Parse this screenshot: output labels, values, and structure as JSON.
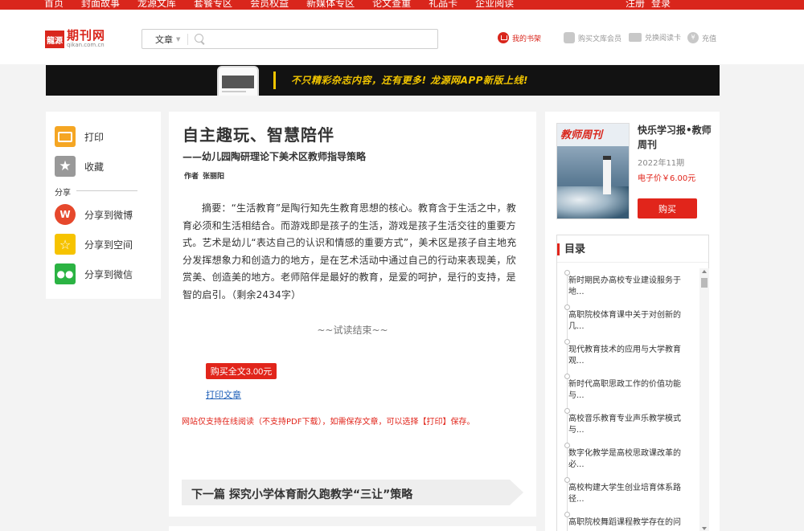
{
  "topnav": {
    "links": [
      "首页",
      "封面故事",
      "龙源文库",
      "套餐专区",
      "会员权益",
      "新媒体专区",
      "论文查重",
      "礼品卡",
      "企业阅读"
    ],
    "register": "注册",
    "login": "登录"
  },
  "header": {
    "logo_badge": "龍源",
    "logo_name": "期刊网",
    "logo_domain": "qikan.com.cn",
    "search_scope": "文章",
    "search_placeholder": "",
    "my_shelf": "我的书架",
    "buy_vip": "购买文库会员",
    "redeem_card": "兑换阅读卡",
    "recharge": "充值",
    "recharge_symbol": "¥"
  },
  "banner": {
    "slogan": "不只精彩杂志内容，还有更多! 龙源网APP新版上线!"
  },
  "share": {
    "print": "打印",
    "favorite": "收藏",
    "section": "分享",
    "weibo": "分享到微博",
    "qzone": "分享到空间",
    "wechat": "分享到微信"
  },
  "article": {
    "title": "自主趣玩、智慧陪伴",
    "subtitle": "——幼儿园陶研理论下美术区教师指导策略",
    "author_label": "作者",
    "author": "张丽阳",
    "abstract": "摘要：“生活教育”是陶行知先生教育思想的核心。教育含于生活之中，教育必须和生活相结合。而游戏即是孩子的生活，游戏是孩子生活交往的重要方式。艺术是幼儿“表达自己的认识和情感的重要方式”，美术区是孩子自主地充分发挥想象力和创造力的地方，是在艺术活动中通过自己的行动来表现美，欣赏美、创造美的地方。老师陪伴是最好的教育，是爱的呵护，是行的支持，是智的启引。（剩余2434字）",
    "trial_end": "~~试读结束~~",
    "buy_full": "购买全文3.00元",
    "print_link": "打印文章",
    "notice": "网站仅支持在线阅读（不支持PDF下载），如需保存文章，可以选择【打印】保存。",
    "next": "下一篇 探究小学体育耐久跑教学“三让”策略"
  },
  "magazine": {
    "cover_title": "教师周刊",
    "name": "快乐学习报•教师周刊",
    "issue": "2022年11期",
    "price": "电子价￥6.00元",
    "buy": "购买"
  },
  "toc": {
    "heading": "目录",
    "items": [
      "新时期民办高校专业建设服务于地...",
      "高职院校体育课中关于对创新的几...",
      "现代教育技术的应用与大学教育观...",
      "新时代高职思政工作的价值功能与...",
      "高校音乐教育专业声乐教学模式与...",
      "数字化教学是高校思政课改革的必...",
      "高校构建大学生创业培育体系路径...",
      "高职院校舞蹈课程教学存在的问"
    ]
  }
}
